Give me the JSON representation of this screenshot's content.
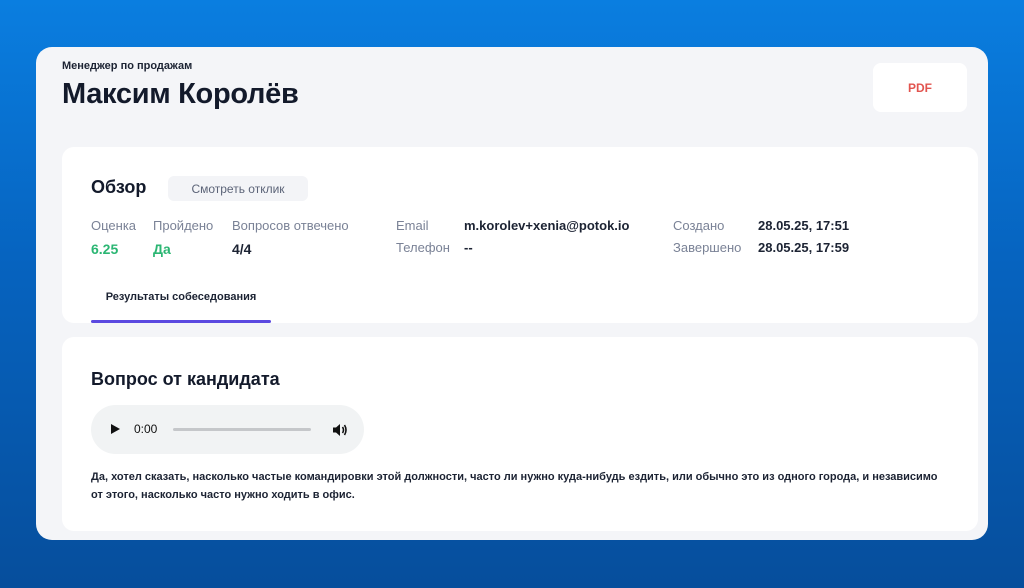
{
  "header": {
    "role": "Менеджер по продажам",
    "name": "Максим Королёв",
    "pdf_label": "PDF"
  },
  "overview": {
    "title": "Обзор",
    "view_response_label": "Смотреть отклик",
    "stats": [
      {
        "label": "Оценка",
        "value": "6.25"
      },
      {
        "label": "Пройдено",
        "value": "Да"
      },
      {
        "label": "Вопросов отвечено",
        "value": "4/4"
      }
    ],
    "contacts": [
      {
        "label": "Email",
        "value": "m.korolev+xenia@potok.io"
      },
      {
        "label": "Телефон",
        "value": "--"
      }
    ],
    "dates": [
      {
        "label": "Создано",
        "value": "28.05.25, 17:51"
      },
      {
        "label": "Завершено",
        "value": "28.05.25, 17:59"
      }
    ],
    "tabs": [
      {
        "label": "Результаты собеседования",
        "active": true
      }
    ],
    "colors": {
      "score": "#2bb673",
      "passed": "#2bb673",
      "tab_accent": "#5b49e0",
      "pdf": "#e2544f"
    }
  },
  "question": {
    "title": "Вопрос от кандидата",
    "player": {
      "time": "0:00",
      "play_icon": "play-icon",
      "volume_icon": "volume-icon",
      "progress": 0
    },
    "transcript": "Да, хотел сказать, насколько частые командировки этой должности, часто ли нужно куда-нибудь ездить, или обычно это из одного города, и независимо от этого, насколько часто нужно ходить в офис."
  }
}
